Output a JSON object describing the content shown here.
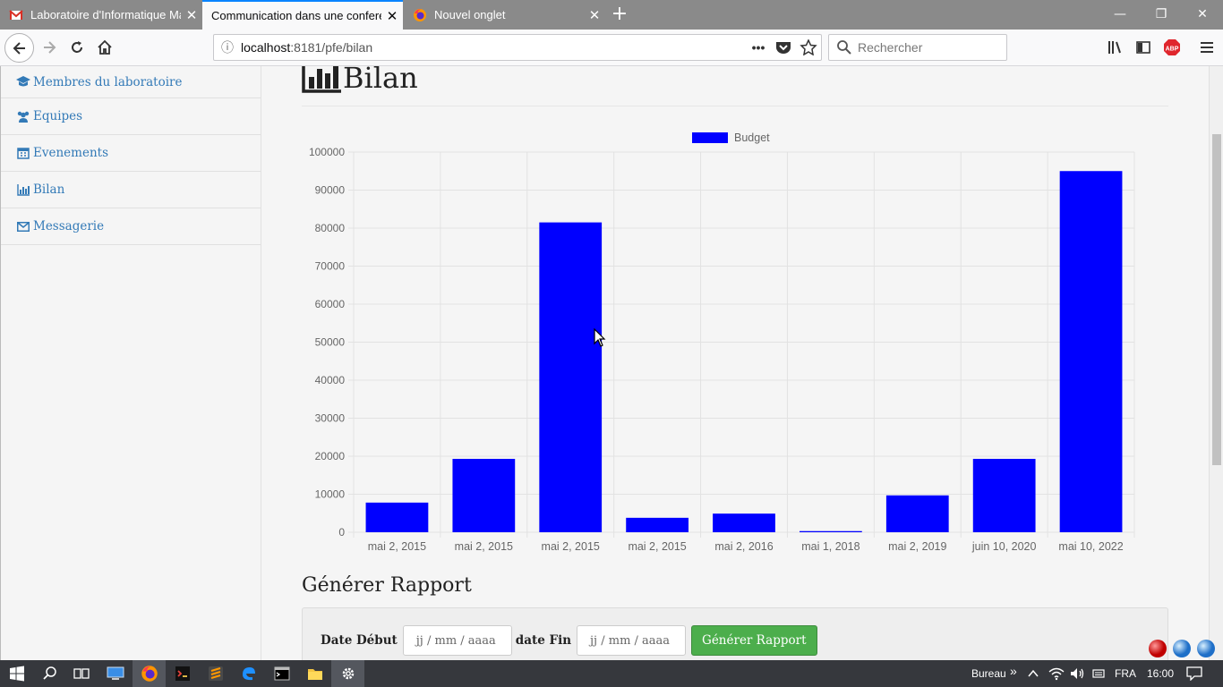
{
  "browser": {
    "tabs": [
      {
        "title": "Laboratoire d'Informatique Ma",
        "active": false,
        "favicon": "gmail-icon"
      },
      {
        "title": "Communication dans une conferen",
        "active": true,
        "favicon": "none"
      },
      {
        "title": "Nouvel onglet",
        "active": false,
        "favicon": "firefox-icon"
      }
    ],
    "url_host": "localhost",
    "url_rest": ":8181/pfe/bilan",
    "search_placeholder": "Rechercher"
  },
  "sidebar": {
    "items": [
      {
        "label": "Membres du laboratoire",
        "icon": "graduation-cap-icon"
      },
      {
        "label": "Equipes",
        "icon": "users-icon"
      },
      {
        "label": "Evenements",
        "icon": "calendar-icon"
      },
      {
        "label": "Bilan",
        "icon": "bar-chart-icon"
      },
      {
        "label": "Messagerie",
        "icon": "envelope-icon"
      }
    ]
  },
  "main": {
    "title": "Bilan",
    "report_title": "Générer Rapport",
    "form": {
      "start_label": "Date Début",
      "start_placeholder": "jj / mm / aaaa",
      "end_label": "date Fin",
      "end_placeholder": "jj / mm / aaaa",
      "button_label": "Générer Rapport"
    }
  },
  "colors": {
    "bar": "#0000ff",
    "link": "#337ab7",
    "button": "#4cae4c"
  },
  "chart_data": {
    "type": "bar",
    "categories": [
      "mai 2, 2015",
      "mai 2, 2015",
      "mai 2, 2015",
      "mai 2, 2015",
      "mai 2, 2016",
      "mai 1, 2018",
      "mai 2, 2019",
      "juin 10, 2020",
      "mai 10, 2022"
    ],
    "series": [
      {
        "name": "Budget",
        "values": [
          7800,
          19300,
          81500,
          3800,
          4900,
          300,
          9700,
          19300,
          95000
        ]
      }
    ],
    "ylim": [
      0,
      100000
    ],
    "yticks": [
      0,
      10000,
      20000,
      30000,
      40000,
      50000,
      60000,
      70000,
      80000,
      90000,
      100000
    ],
    "legend": "top-center",
    "grid": true
  },
  "taskbar": {
    "desktop_label": "Bureau",
    "language": "FRA",
    "time": "16:00"
  }
}
